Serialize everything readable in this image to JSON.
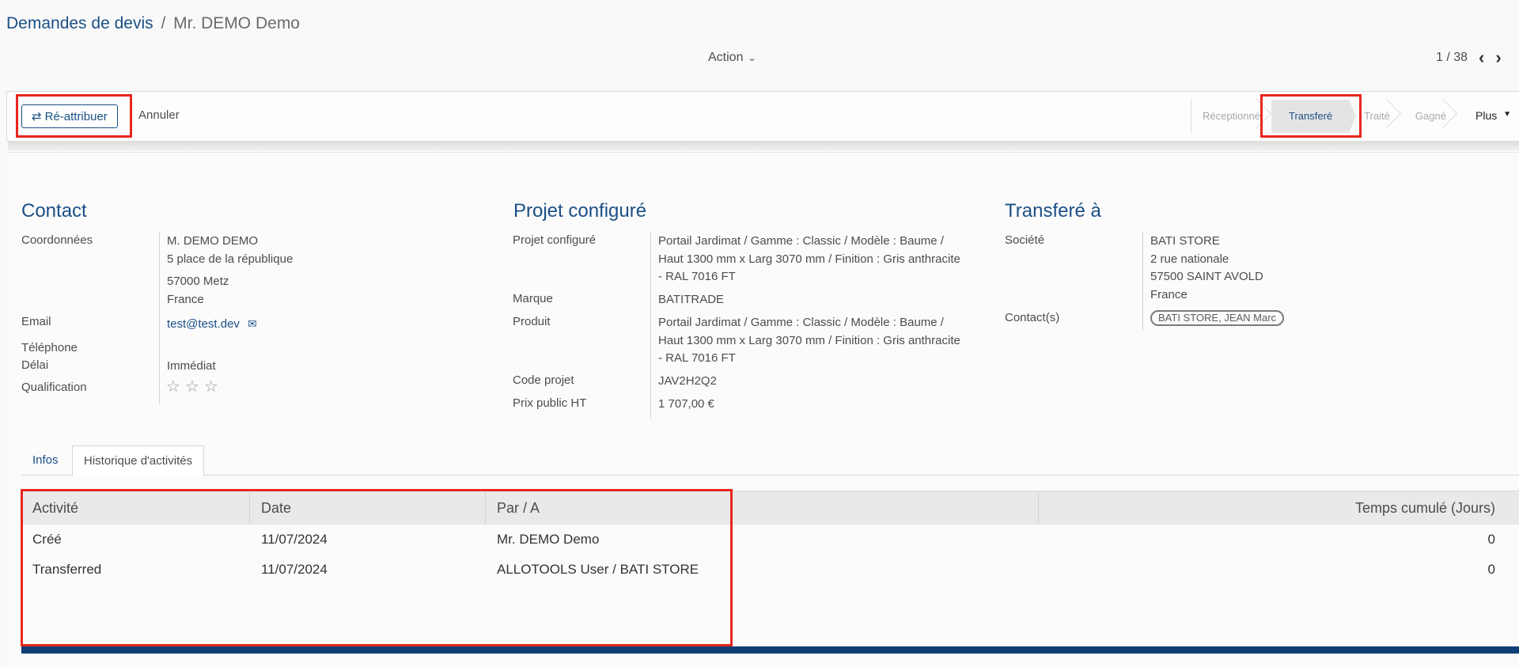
{
  "breadcrumb": {
    "root": "Demandes de devis",
    "separator": "/",
    "current": "Mr. DEMO Demo"
  },
  "action_menu": {
    "label": "Action"
  },
  "pager": {
    "value": "1 / 38"
  },
  "controls": {
    "reassign_label": "Ré-attribuer",
    "cancel_label": "Annuler"
  },
  "stages": [
    {
      "label": "Réceptionné",
      "active": false
    },
    {
      "label": "Transferé",
      "active": true
    },
    {
      "label": "Traité",
      "active": false
    },
    {
      "label": "Gagné",
      "active": false
    }
  ],
  "more_label": "Plus",
  "contact": {
    "title": "Contact",
    "coordonnees_label": "Coordonnées",
    "name": "M.  DEMO  DEMO",
    "address1": "5 place de la république",
    "zip_city": "57000  Metz",
    "country": "France",
    "email_label": "Email",
    "email": "test@test.dev",
    "phone_label": "Téléphone",
    "delay_label": "Délai",
    "delay": "Immédiat",
    "qualification_label": "Qualification",
    "rating": 0
  },
  "project": {
    "title": "Projet configuré",
    "project_label": "Projet configuré",
    "project_line1": "Portail Jardimat / Gamme : Classic / Modèle : Baume /",
    "project_line2": "Haut 1300 mm x Larg 3070 mm / Finition : Gris anthracite",
    "project_line3": "- RAL 7016 FT",
    "brand_label": "Marque",
    "brand": "BATITRADE",
    "product_label": "Produit",
    "product_line1": "Portail Jardimat / Gamme : Classic / Modèle : Baume /",
    "product_line2": "Haut 1300 mm x Larg 3070 mm / Finition : Gris anthracite",
    "product_line3": "- RAL 7016 FT",
    "code_label": "Code projet",
    "code": "JAV2H2Q2",
    "price_label": "Prix public HT",
    "price": "1 707,00 €"
  },
  "transfer": {
    "title": "Transferé à",
    "company_label": "Société",
    "company": "BATI STORE",
    "address1": "2 rue nationale",
    "zip_city": "57500 SAINT AVOLD",
    "country": "France",
    "contacts_label": "Contact(s)",
    "contact_badge": "BATI STORE, JEAN Marc"
  },
  "tabs": [
    {
      "label": "Infos",
      "active": false
    },
    {
      "label": "Historique d'activités",
      "active": true
    }
  ],
  "history": {
    "headers": [
      "Activité",
      "Date",
      "Par / A",
      "Temps cumulé (Jours)"
    ],
    "rows": [
      [
        "Créé",
        "11/07/2024",
        "Mr. DEMO Demo",
        "0"
      ],
      [
        "Transferred",
        "11/07/2024",
        "ALLOTOOLS User / BATI STORE",
        "0"
      ]
    ]
  },
  "colors": {
    "accent": "#1b4f86",
    "highlight_box": "#e8261f",
    "bottom_bar": "#0f3e74"
  },
  "icons": [
    "chevron-down-icon",
    "chevron-left-icon",
    "chevron-right-icon",
    "refresh-icon",
    "envelope-icon",
    "star-outline-icon",
    "caret-down-icon"
  ]
}
